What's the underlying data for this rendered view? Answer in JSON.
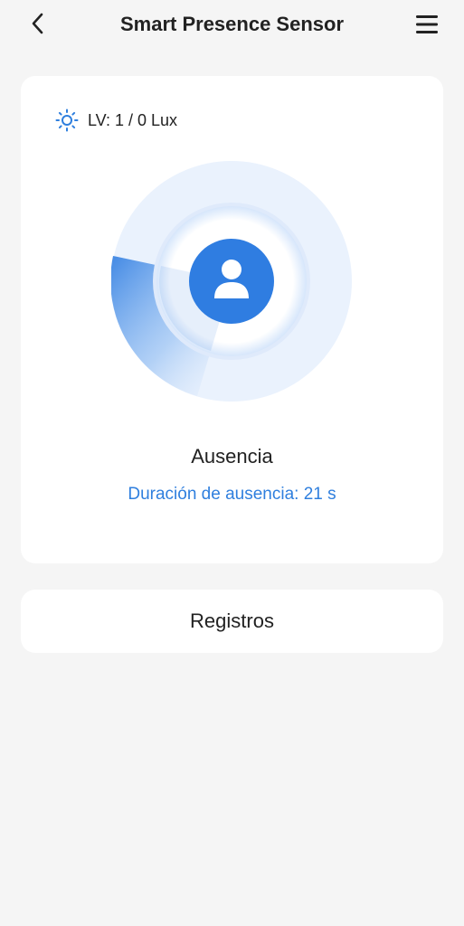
{
  "header": {
    "title": "Smart Presence Sensor",
    "back_icon": "chevron-left-icon",
    "menu_icon": "hamburger-menu-icon"
  },
  "sensor": {
    "lux_label": "LV: 1 / 0 Lux",
    "lux_icon": "sun-icon",
    "status": "Ausencia",
    "duration": "Duración de ausencia: 21 s",
    "person_icon": "person-icon"
  },
  "records": {
    "label": "Registros"
  },
  "colors": {
    "accent": "#2f7fde",
    "radar_outer": "#eaf2fd",
    "person_circle": "#2f7de1",
    "background": "#f5f5f5"
  }
}
